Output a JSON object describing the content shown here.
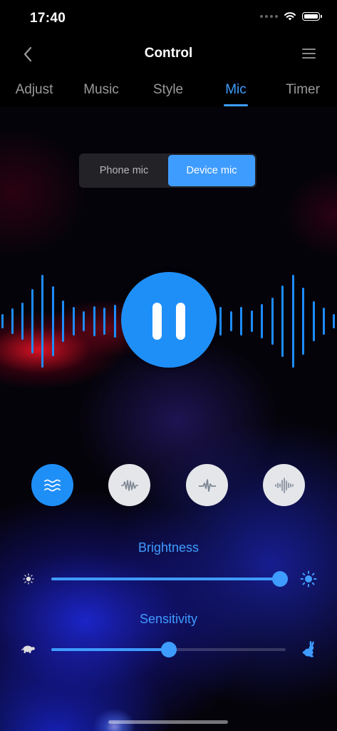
{
  "status_bar": {
    "time": "17:40"
  },
  "header": {
    "title": "Control"
  },
  "tabs": [
    {
      "label": "Adjust",
      "active": false
    },
    {
      "label": "Music",
      "active": false
    },
    {
      "label": "Style",
      "active": false
    },
    {
      "label": "Mic",
      "active": true
    },
    {
      "label": "Timer",
      "active": false
    }
  ],
  "mic_source": {
    "options": [
      "Phone mic",
      "Device mic"
    ],
    "selected": "Device mic"
  },
  "player": {
    "state": "playing",
    "control_icon": "pause-icon"
  },
  "modes": [
    {
      "icon": "waves-icon",
      "active": true
    },
    {
      "icon": "soundwave-icon",
      "active": false
    },
    {
      "icon": "pulse-icon",
      "active": false
    },
    {
      "icon": "spectrum-icon",
      "active": false
    }
  ],
  "brightness": {
    "label": "Brightness",
    "value": 1.0,
    "min_icon": "sun-small-icon",
    "max_icon": "sun-large-icon"
  },
  "sensitivity": {
    "label": "Sensitivity",
    "value": 0.5,
    "min_icon": "turtle-icon",
    "max_icon": "rabbit-icon"
  },
  "colors": {
    "accent": "#3f9cff",
    "button": "#1f8ff8",
    "bars": "#1e8cff"
  }
}
